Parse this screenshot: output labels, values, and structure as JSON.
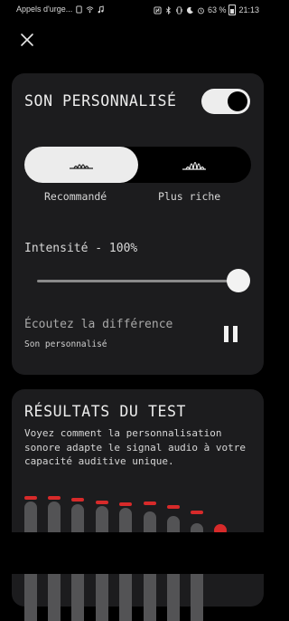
{
  "status_bar": {
    "left_text": "Appels d'urge...",
    "battery": "63 %",
    "time": "21:13",
    "icons": [
      "sim-icon",
      "wifi-icon",
      "music-icon",
      "nfc-icon",
      "bluetooth-icon",
      "vibrate-icon",
      "moon-icon",
      "alarm-icon",
      "battery-icon"
    ]
  },
  "toolbar": {
    "close_icon": "close-icon"
  },
  "personalized_sound": {
    "title": "SON PERSONNALISÉ",
    "toggle_on": true,
    "profiles": [
      {
        "label": "Recommandé",
        "selected": true,
        "icon": "waveform-soft-icon"
      },
      {
        "label": "Plus riche",
        "selected": false,
        "icon": "waveform-rich-icon"
      }
    ],
    "intensity_label": "Intensité - 100%",
    "intensity_value": 1.0,
    "listen_title": "Écoutez la différence",
    "listen_subtitle": "Son personnalisé",
    "player_state_icon": "pause-icon"
  },
  "test_results": {
    "title": "RÉSULTATS DU TEST",
    "description": "Voyez comment la personnalisation sonore adapte le signal audio à votre capacité auditive unique.",
    "accent_color": "#d72a2a"
  }
}
